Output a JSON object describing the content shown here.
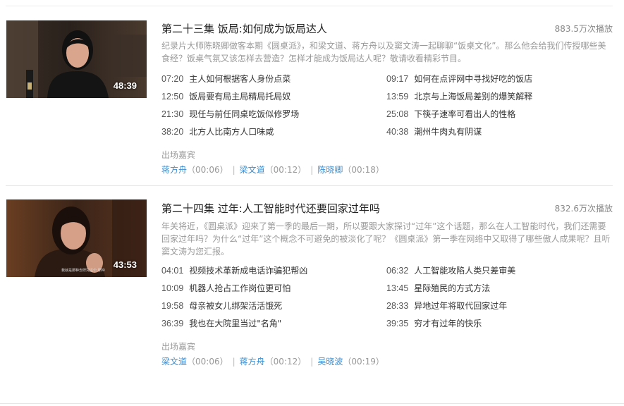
{
  "episodes": [
    {
      "duration": "48:39",
      "title": "第二十三集 饭局:如何成为饭局达人",
      "plays": "883.5万次播放",
      "description": "纪录片大师陈晓卿做客本期《圆桌派》，和梁文道、蒋方舟以及窦文涛一起聊聊“饭桌文化”。那么他会给我们传授哪些美食经？饭桌气氛又该怎样去营造？怎样才能成为饭局达人呢？敬请收看精彩节目。",
      "chapters": [
        {
          "time": "07:20",
          "text": "主人如何根据客人身份点菜"
        },
        {
          "time": "09:17",
          "text": "如何在点评网中寻找好吃的饭店"
        },
        {
          "time": "12:50",
          "text": "饭局要有局主局精局托局奴"
        },
        {
          "time": "13:59",
          "text": "北京与上海饭局差别的爆笑解释"
        },
        {
          "time": "21:30",
          "text": "现任与前任同桌吃饭似修罗场"
        },
        {
          "time": "25:08",
          "text": "下筷子速率可看出人的性格"
        },
        {
          "time": "38:20",
          "text": "北方人比南方人口味咸"
        },
        {
          "time": "40:38",
          "text": "潮州牛肉丸有阴谋"
        }
      ],
      "guests_label": "出场嘉宾",
      "guests": [
        {
          "name": "蒋方舟",
          "time": "（00:06）"
        },
        {
          "name": "梁文道",
          "time": "（00:12）"
        },
        {
          "name": "陈晓卿",
          "time": "（00:18）"
        }
      ],
      "separator": "|"
    },
    {
      "duration": "43:53",
      "title": "第二十四集 过年:人工智能时代还要回家过年吗",
      "plays": "832.6万次播放",
      "description": "年关将近，《圆桌派》迎来了第一季的最后一期，所以要跟大家探讨“过年”这个话题，那么在人工智能时代，我们还需要回家过年吗？为什么“过年”这个概念不可避免的被淡化了呢？《圆桌派》第一季在网络中又取得了哪些傲人成果呢？且听窦文涛为您汇报。",
      "subtitle_overlay": "我就是那种去研究这个 那种",
      "chapters": [
        {
          "time": "04:01",
          "text": "视频技术革新成电话诈骗犯帮凶"
        },
        {
          "time": "06:32",
          "text": "人工智能攻陷人类只差审美"
        },
        {
          "time": "10:09",
          "text": "机器人抢占工作岗位更可怕"
        },
        {
          "time": "13:45",
          "text": "星际殖民的方式方法"
        },
        {
          "time": "19:58",
          "text": "母亲被女儿绑架活活饿死"
        },
        {
          "time": "28:33",
          "text": "异地过年将取代回家过年"
        },
        {
          "time": "36:39",
          "text": "我也在大院里当过\"名角\""
        },
        {
          "time": "39:35",
          "text": "穷才有过年的快乐"
        }
      ],
      "guests_label": "出场嘉宾",
      "guests": [
        {
          "name": "梁文道",
          "time": "（00:06）"
        },
        {
          "name": "蒋方舟",
          "time": "（00:12）"
        },
        {
          "name": "吴晓波",
          "time": "（00:19）"
        }
      ],
      "separator": "|"
    }
  ]
}
